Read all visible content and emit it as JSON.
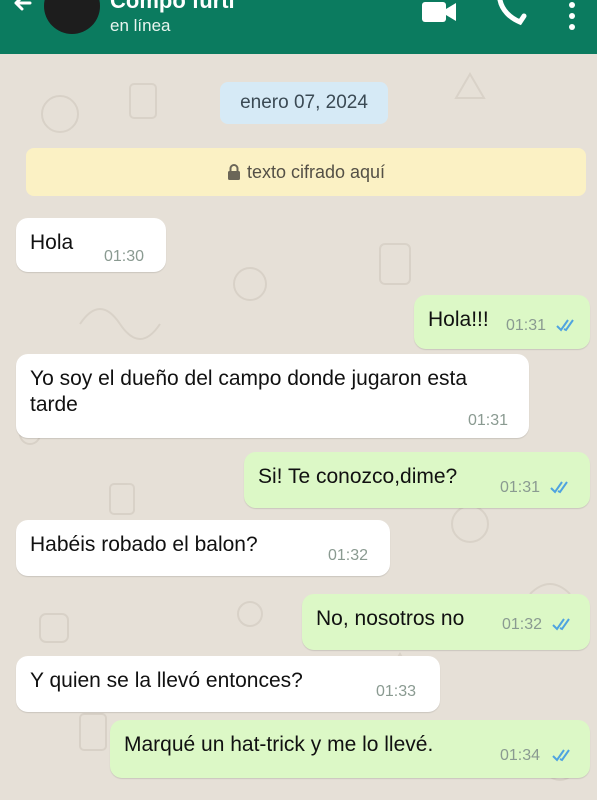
{
  "header": {
    "contact_name": "Compo fúrtl",
    "status": "en línea",
    "icons": [
      "back-arrow-icon",
      "video-call-icon",
      "phone-icon",
      "more-options-icon"
    ]
  },
  "chat": {
    "date_chip": "enero 07, 2024",
    "encryption_notice": "texto cifrado aquí",
    "messages": [
      {
        "direction": "in",
        "text": "Hola",
        "time": "01:30"
      },
      {
        "direction": "out",
        "text": "Hola!!!",
        "time": "01:31",
        "read": true
      },
      {
        "direction": "in",
        "text": "Yo soy el dueño del campo donde jugaron esta tarde",
        "time": "01:31"
      },
      {
        "direction": "out",
        "text": "Si! Te conozco,dime?",
        "time": "01:31",
        "read": true
      },
      {
        "direction": "in",
        "text": "Habéis robado el balon?",
        "time": "01:32"
      },
      {
        "direction": "out",
        "text": "No, nosotros no",
        "time": "01:32",
        "read": true
      },
      {
        "direction": "in",
        "text": "Y quien se la llevó entonces?",
        "time": "01:33"
      },
      {
        "direction": "out",
        "text": "Marqué un hat-trick y me lo llevé.",
        "time": "01:34",
        "read": true
      }
    ]
  },
  "colors": {
    "header": "#0b7b5f",
    "outgoing_bubble": "#dcf8c6",
    "incoming_bubble": "#ffffff",
    "read_ticks": "#4fa3e0"
  }
}
